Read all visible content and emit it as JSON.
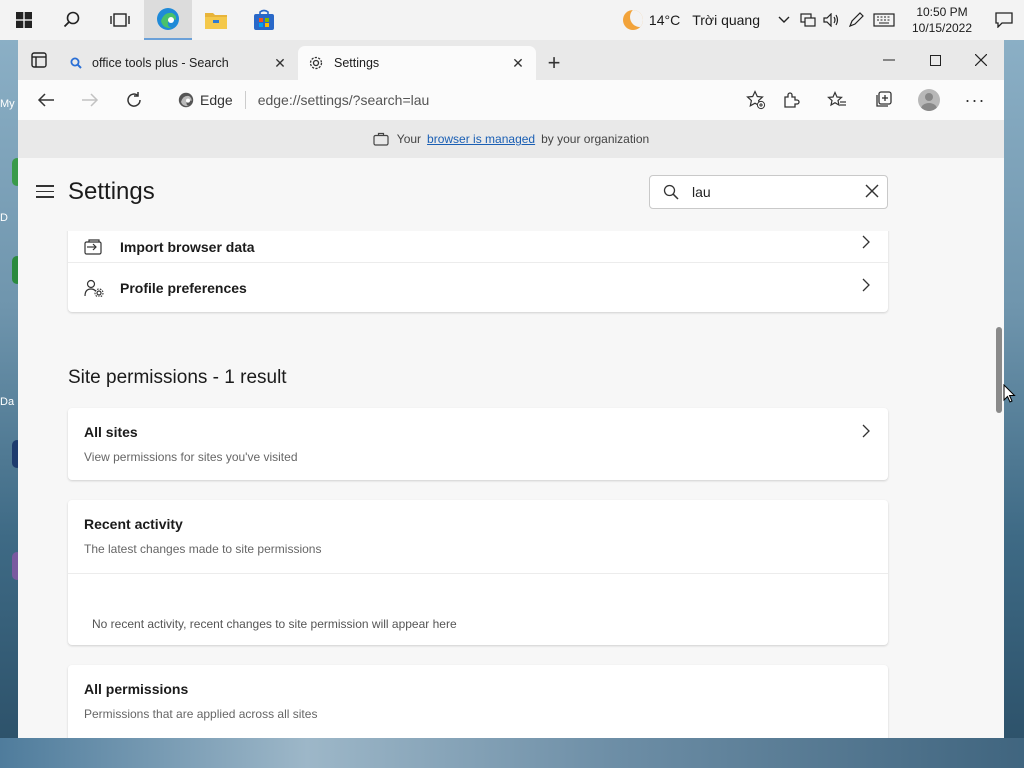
{
  "desktop": {
    "fragments": [
      "My",
      "D",
      "Da"
    ]
  },
  "taskbar": {
    "icons": [
      "windows-start-icon",
      "search-icon",
      "task-view-icon",
      "edge-icon",
      "file-explorer-icon",
      "store-icon"
    ],
    "weather": {
      "temp": "14°C",
      "text": "Trời quang"
    },
    "clock": {
      "time": "10:50 PM",
      "date": "10/15/2022"
    }
  },
  "browser": {
    "tabs": [
      {
        "title": "office tools plus - Search",
        "icon": "search-icon",
        "active": false
      },
      {
        "title": "Settings",
        "icon": "gear-icon",
        "active": true
      }
    ],
    "address": {
      "brand": "Edge",
      "url": "edge://settings/?search=lau"
    },
    "infobar": {
      "prefix": "Your",
      "link": "browser is managed",
      "suffix": "by your organization"
    }
  },
  "settings": {
    "title": "Settings",
    "search": {
      "value": "lau",
      "placeholder": "Search settings"
    },
    "profile_rows": [
      {
        "label": "Import browser data",
        "icon": "import-icon"
      },
      {
        "label": "Profile preferences",
        "icon": "profile-preferences-icon"
      }
    ],
    "section_title": "Site permissions - 1 result",
    "all_sites": {
      "title": "All sites",
      "subtitle": "View permissions for sites you've visited"
    },
    "recent_activity": {
      "title": "Recent activity",
      "subtitle": "The latest changes made to site permissions",
      "empty": "No recent activity, recent changes to site permission will appear here"
    },
    "all_permissions": {
      "title": "All permissions",
      "subtitle": "Permissions that are applied across all sites"
    }
  }
}
